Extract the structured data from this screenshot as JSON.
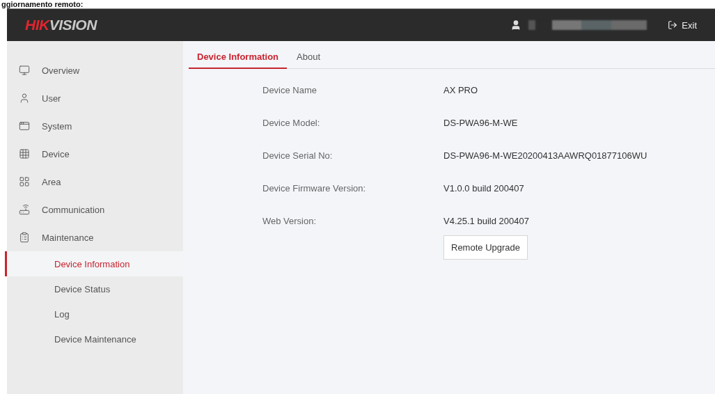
{
  "caption": "ggiornamento remoto:",
  "header": {
    "logo": [
      "HIK",
      "VISION"
    ],
    "exit": "Exit"
  },
  "sidebar": {
    "items": [
      {
        "label": "Overview",
        "selected": false
      },
      {
        "label": "User",
        "selected": false
      },
      {
        "label": "System",
        "selected": false
      },
      {
        "label": "Device",
        "selected": false
      },
      {
        "label": "Area",
        "selected": false
      },
      {
        "label": "Communication",
        "selected": false
      },
      {
        "label": "Maintenance",
        "selected": false,
        "children": [
          {
            "label": "Device Information",
            "selected": true
          },
          {
            "label": "Device Status",
            "selected": false
          },
          {
            "label": "Log",
            "selected": false
          },
          {
            "label": "Device Maintenance",
            "selected": false
          }
        ]
      }
    ]
  },
  "tabs": [
    {
      "label": "Device Information",
      "selected": true
    },
    {
      "label": "About",
      "selected": false
    }
  ],
  "fields": [
    {
      "label": "Device Name",
      "value": "AX PRO"
    },
    {
      "label": "Device Model:",
      "value": "DS-PWA96-M-WE"
    },
    {
      "label": "Device Serial No:",
      "value": "DS-PWA96-M-WE20200413AAWRQ01877106WU"
    },
    {
      "label": "Device Firmware Version:",
      "value": "V1.0.0 build 200407"
    },
    {
      "label": "Web Version:",
      "value": "V4.25.1 build 200407"
    }
  ],
  "button": "Remote Upgrade"
}
